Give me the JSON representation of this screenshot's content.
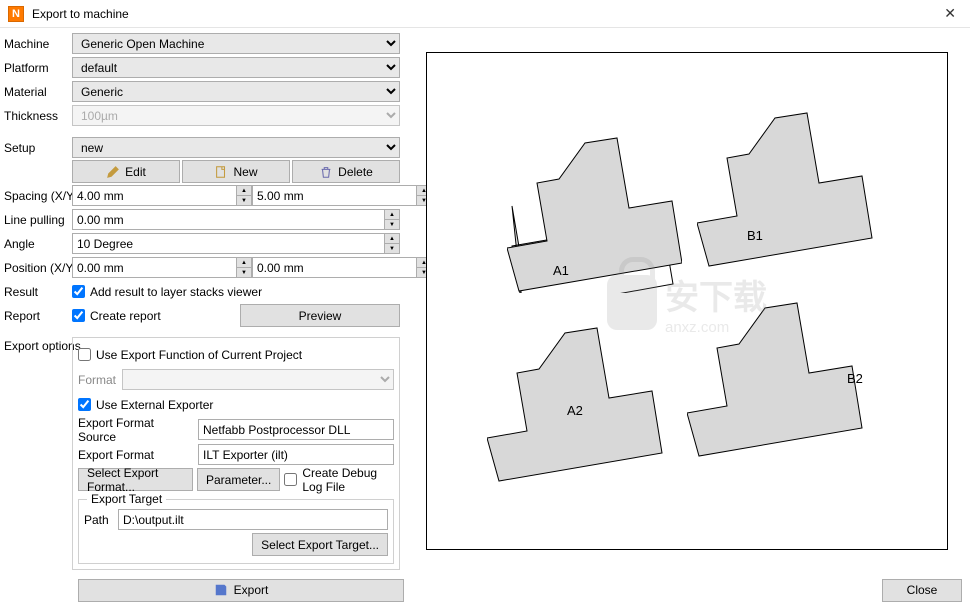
{
  "window": {
    "title": "Export to machine"
  },
  "labels": {
    "machine": "Machine",
    "platform": "Platform",
    "material": "Material",
    "thickness": "Thickness",
    "setup": "Setup",
    "edit": "Edit",
    "new": "New",
    "delete": "Delete",
    "spacing": "Spacing (X/Y)",
    "linepull": "Line pulling",
    "angle": "Angle",
    "position": "Position (X/Y)",
    "result": "Result",
    "report": "Report",
    "preview": "Preview",
    "exportopts": "Export options",
    "usefunc": "Use Export Function of Current Project",
    "format": "Format",
    "useext": "Use External Exporter",
    "srcfmt": "Export Format Source",
    "expfmt": "Export Format",
    "selfmt": "Select Export Format...",
    "param": "Parameter...",
    "debug": "Create Debug Log File",
    "target": "Export Target",
    "path": "Path",
    "seltgt": "Select Export Target...",
    "addresult": "Add result to layer stacks viewer",
    "createrep": "Create report",
    "export": "Export",
    "close": "Close"
  },
  "values": {
    "machine": "Generic Open Machine",
    "platform": "default",
    "material": "Generic",
    "thickness": "100µm",
    "setup": "new",
    "spacingX": "4.00 mm",
    "spacingY": "5.00 mm",
    "linepull": "0.00 mm",
    "angle": "10 Degree",
    "posX": "0.00 mm",
    "posY": "0.00 mm",
    "srcfmt": "Netfabb Postprocessor DLL",
    "expfmt": "ILT Exporter (ilt)",
    "path": "D:\\output.ilt"
  },
  "shapes": {
    "a1": "A1",
    "b1": "B1",
    "a2": "A2",
    "b2": "B2"
  }
}
